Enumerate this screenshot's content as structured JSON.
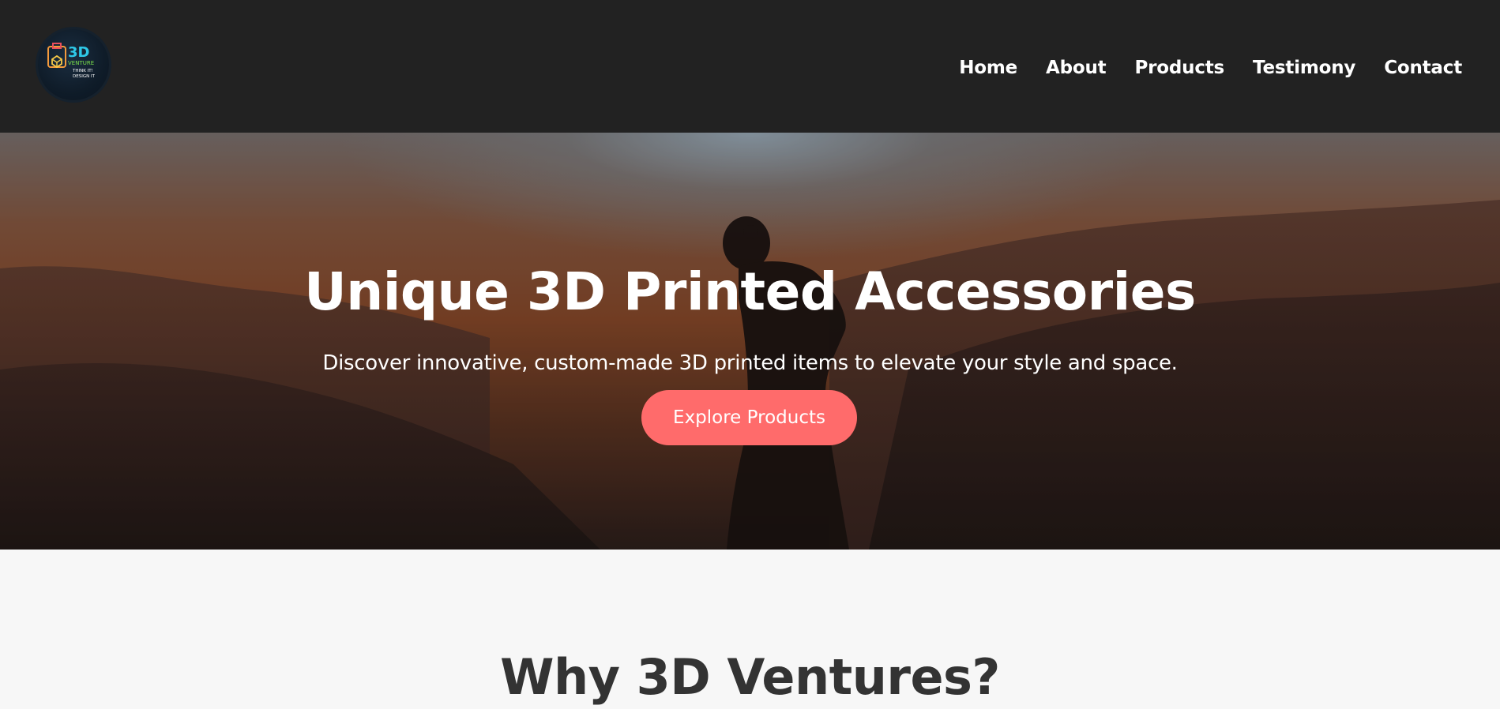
{
  "brand": {
    "logo_text": "3D",
    "logo_sub": "VENTURE",
    "logo_tagline_1": "THINK IT!",
    "logo_tagline_2": "DESIGN IT"
  },
  "nav": {
    "items": [
      {
        "label": "Home"
      },
      {
        "label": "About"
      },
      {
        "label": "Products"
      },
      {
        "label": "Testimony"
      },
      {
        "label": "Contact"
      }
    ]
  },
  "hero": {
    "title": "Unique 3D Printed Accessories",
    "subtitle": "Discover innovative, custom-made 3D printed items to elevate your style and space.",
    "cta_label": "Explore Products"
  },
  "why": {
    "title": "Why 3D Ventures?"
  },
  "colors": {
    "header_bg": "#222222",
    "accent": "#ff6b6b",
    "page_bg": "#f7f7f7"
  }
}
